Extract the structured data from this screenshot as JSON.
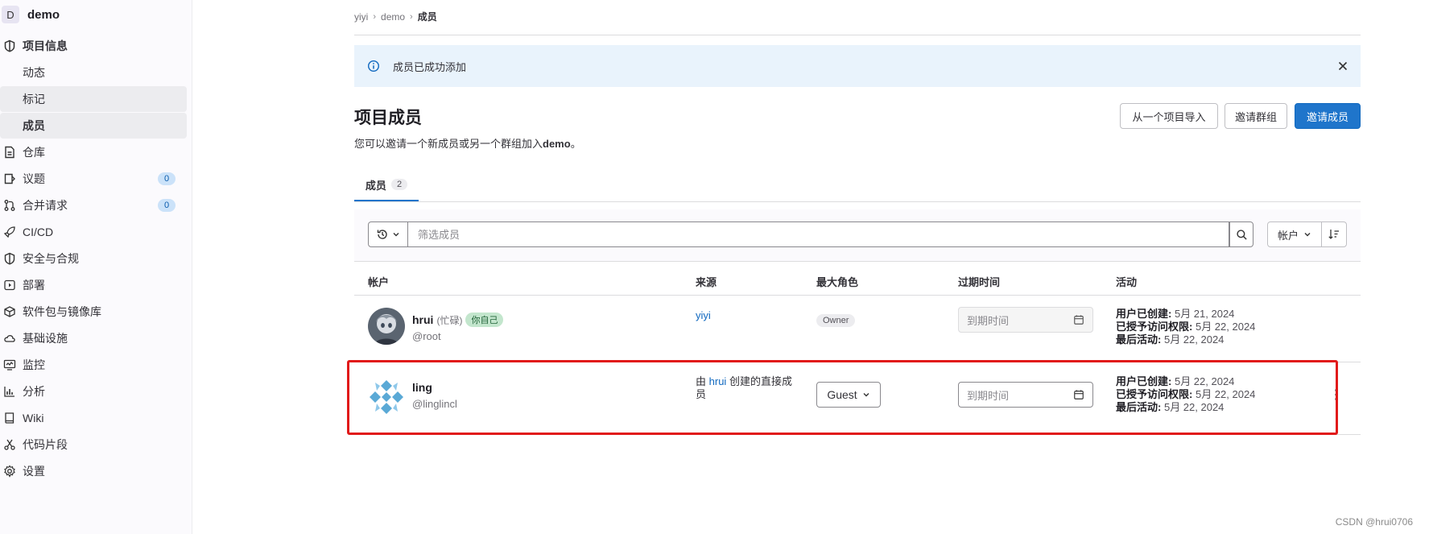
{
  "project": {
    "avatar_letter": "D",
    "name": "demo"
  },
  "sidebar": {
    "items": [
      {
        "label": "项目信息",
        "icon": "project-icon"
      },
      {
        "label": "动态"
      },
      {
        "label": "标记"
      },
      {
        "label": "成员"
      },
      {
        "label": "仓库",
        "icon": "repository-icon"
      },
      {
        "label": "议题",
        "icon": "issues-icon",
        "count": "0"
      },
      {
        "label": "合并请求",
        "icon": "merge-request-icon",
        "count": "0"
      },
      {
        "label": "CI/CD",
        "icon": "rocket-icon"
      },
      {
        "label": "安全与合规",
        "icon": "shield-icon"
      },
      {
        "label": "部署",
        "icon": "deploy-icon"
      },
      {
        "label": "软件包与镜像库",
        "icon": "package-icon"
      },
      {
        "label": "基础设施",
        "icon": "cloud-icon"
      },
      {
        "label": "监控",
        "icon": "monitor-icon"
      },
      {
        "label": "分析",
        "icon": "chart-icon"
      },
      {
        "label": "Wiki",
        "icon": "book-icon"
      },
      {
        "label": "代码片段",
        "icon": "snippet-icon"
      },
      {
        "label": "设置",
        "icon": "gear-icon"
      }
    ]
  },
  "breadcrumb": {
    "items": [
      "yiyi",
      "demo",
      "成员"
    ]
  },
  "alert": {
    "text": "成员已成功添加"
  },
  "page": {
    "title": "项目成员",
    "desc_prefix": "您可以邀请一个新成员或另一个群组加入",
    "desc_project": "demo",
    "desc_suffix": "。"
  },
  "buttons": {
    "import": "从一个项目导入",
    "invite_group": "邀请群组",
    "invite_members": "邀请成员"
  },
  "tabs": {
    "members_label": "成员",
    "members_count": "2"
  },
  "filter": {
    "placeholder": "筛选成员",
    "sort_label": "帐户"
  },
  "table": {
    "headers": {
      "account": "帐户",
      "source": "来源",
      "role": "最大角色",
      "expiry": "过期时间",
      "activity": "活动"
    }
  },
  "members": [
    {
      "name": "hrui",
      "status": "(忙碌)",
      "self_badge": "你自己",
      "handle": "@root",
      "source_link": "yiyi",
      "role": "Owner",
      "expiry_placeholder": "到期时间",
      "activity": {
        "created_label": "用户已创建:",
        "created": "5月 21, 2024",
        "granted_label": "已授予访问权限:",
        "granted": "5月 22, 2024",
        "last_label": "最后活动:",
        "last": "5月 22, 2024"
      }
    },
    {
      "name": "ling",
      "handle": "@linglincl",
      "source_prefix": "由",
      "source_link": "hrui",
      "source_suffix": "创建的直接成员",
      "role": "Guest",
      "expiry_placeholder": "到期时间",
      "activity": {
        "created_label": "用户已创建:",
        "created": "5月 22, 2024",
        "granted_label": "已授予访问权限:",
        "granted": "5月 22, 2024",
        "last_label": "最后活动:",
        "last": "5月 22, 2024"
      }
    }
  ],
  "watermark": "CSDN @hrui0706"
}
